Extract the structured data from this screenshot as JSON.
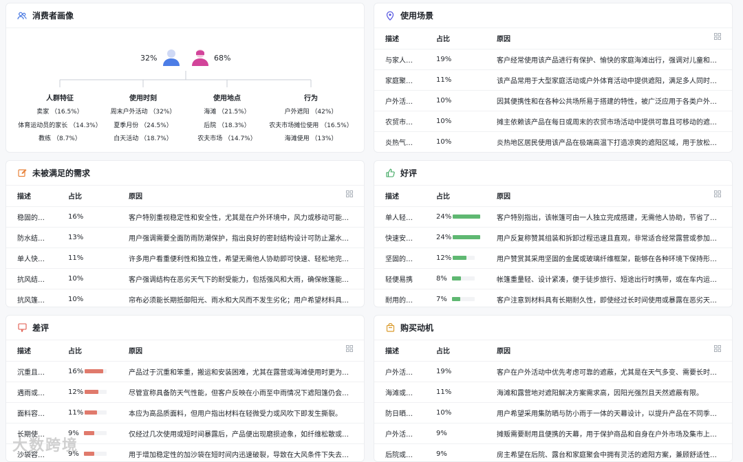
{
  "persona": {
    "title": "消费者画像",
    "male_pct": "32%",
    "female_pct": "68%",
    "columns": [
      {
        "header": "人群特征",
        "items": [
          "卖家 （16.5%）",
          "体育运动员的家长 （14.3%）",
          "教练 （8.7%）"
        ]
      },
      {
        "header": "使用时刻",
        "items": [
          "周末户外活动 （32%）",
          "夏季月份 （24.5%）",
          "白天活动 （18.7%）"
        ]
      },
      {
        "header": "使用地点",
        "items": [
          "海滩 （21.5%）",
          "后院 （18.3%）",
          "农夫市场 （14.7%）"
        ]
      },
      {
        "header": "行为",
        "items": [
          "户外遮阳 （42%）",
          "农夫市场摊位使用 （16.5%）",
          "海滩使用 （13%）"
        ]
      }
    ]
  },
  "scenes": {
    "title": "使用场景",
    "headers": [
      "描述",
      "占比",
      "原因"
    ],
    "rows": [
      {
        "desc": "与家人共...",
        "pct": "19%",
        "reason": "客户经常使用该产品进行有保护、愉快的家庭海滩出行，强调对儿童和成人..."
      },
      {
        "desc": "家庭聚会...",
        "pct": "11%",
        "reason": "该产品常用于大型家庭活动或户外体育活动中提供遮阳，满足多人同时遮蔽..."
      },
      {
        "desc": "户外活动...",
        "pct": "10%",
        "reason": "因其便携性和在各种公共场所易于搭建的特性，被广泛应用于各类户外社交..."
      },
      {
        "desc": "农贸市场...",
        "pct": "10%",
        "reason": "摊主依赖该产品在每日或周末的农贸市场活动中提供可靠且可移动的遮阳。"
      },
      {
        "desc": "炎热气候...",
        "pct": "10%",
        "reason": "炎热地区居民使用该产品在极端高温下打造凉爽的遮阳区域，用于放松或招..."
      }
    ]
  },
  "unmet": {
    "title": "未被满足的需求",
    "headers": [
      "描述",
      "占比",
      "原因"
    ],
    "rows": [
      {
        "desc": "稳固的固...",
        "pct": "16%",
        "reason": "客户特别重视稳定性和安全性，尤其是在户外环境中，风力或移动可能影响..."
      },
      {
        "desc": "防水结构...",
        "pct": "13%",
        "reason": "用户强调需要全面防雨防潮保护，指出良好的密封结构设计可防止漏水，保..."
      },
      {
        "desc": "单人快速...",
        "pct": "11%",
        "reason": "许多用户看重便利性和独立性，希望无需他人协助即可快速、轻松地完成搭..."
      },
      {
        "desc": "抗风结构...",
        "pct": "10%",
        "reason": "客户强调结构在恶劣天气下的耐受能力，包括强风和大雨，确保帐篷能够保..."
      },
      {
        "desc": "抗风篷布...",
        "pct": "10%",
        "reason": "帘布必须能长期抵御阳光、雨水和大风而不发生劣化；用户希望材料具备抗..."
      }
    ]
  },
  "good": {
    "title": "好评",
    "headers": [
      "描述",
      "占比",
      "原因"
    ],
    "color": "#5fb872",
    "rows": [
      {
        "desc": "单人轻松...",
        "pct": "24%",
        "value": 24,
        "reason": "客户特别指出，该帐篷可由一人独立完成搭建，无需他人协助，节省了户外..."
      },
      {
        "desc": "快速安装...",
        "pct": "24%",
        "value": 24,
        "reason": "用户反复称赞其组装和拆卸过程迅速且直观，非常适合经常露营或参加活动..."
      },
      {
        "desc": "坚固的框...",
        "pct": "12%",
        "value": 12,
        "reason": "用户赞赏其采用坚固的金属或玻璃纤维框架，能够在各种环境下保持形状和..."
      },
      {
        "desc": "轻便易携",
        "pct": "8%",
        "value": 8,
        "reason": "帐篷重量轻、设计紧凑，便于徒步旅行、短途出行时携带，或在车内运输。"
      },
      {
        "desc": "耐用的构造",
        "pct": "7%",
        "value": 7,
        "reason": "客户注意到材料具有长期耐久性，即使经过长时间使用或暴露在恶劣天气下..."
      }
    ]
  },
  "bad": {
    "title": "差评",
    "headers": [
      "描述",
      "占比",
      "原因"
    ],
    "color": "#e07a6c",
    "rows": [
      {
        "desc": "沉重且体...",
        "pct": "16%",
        "value": 16,
        "reason": "产品过于沉重和笨重，搬运和安装困难，尤其在露营或海滩使用时更为明显。"
      },
      {
        "desc": "遇雨或潮...",
        "pct": "12%",
        "value": 12,
        "reason": "尽管宣称具备防天气性能，但客户反映在小雨至中雨情况下遮阳篷仍会漏水..."
      },
      {
        "desc": "面料容易...",
        "pct": "11%",
        "value": 11,
        "reason": "本应为高品质面料，但用户指出材料在轻微受力或风吹下即发生撕裂。"
      },
      {
        "desc": "长期使用...",
        "pct": "9%",
        "value": 9,
        "reason": "仅经过几次使用或短时间暴露后，产品便出现磨损迹象，如纤维松散或破裂。"
      },
      {
        "desc": "沙袋容易...",
        "pct": "9%",
        "value": 9,
        "reason": "用于增加稳定性的加沙袋在短时间内迅速破裂，导致在大风条件下失去效用。"
      }
    ]
  },
  "motive": {
    "title": "购买动机",
    "headers": [
      "描述",
      "占比",
      "原因"
    ],
    "rows": [
      {
        "desc": "户外活动...",
        "pct": "19%",
        "reason": "客户在户外活动中优先考虑可靠的遮蔽，尤其是在天气多变、需要长时间使..."
      },
      {
        "desc": "海滩或露...",
        "pct": "11%",
        "reason": "海滩和露营地对遮阳解决方案需求高，因阳光强烈且天然遮蔽有限。"
      },
      {
        "desc": "防日晒与...",
        "pct": "10%",
        "reason": "用户希望采用集防晒与防小雨于一体的天幕设计，以提升产品在不同季节中..."
      },
      {
        "desc": "户外活动...",
        "pct": "9%",
        "reason": "摊贩需要耐用且便携的天幕，用于保护商品和自身在户外市场及集市上的安..."
      },
      {
        "desc": "后院或活...",
        "pct": "9%",
        "reason": "房主希望在后院、露台和家庭聚会中拥有灵活的遮阳方案，兼顾舒适性与实..."
      }
    ]
  },
  "watermark": "大数跨境"
}
